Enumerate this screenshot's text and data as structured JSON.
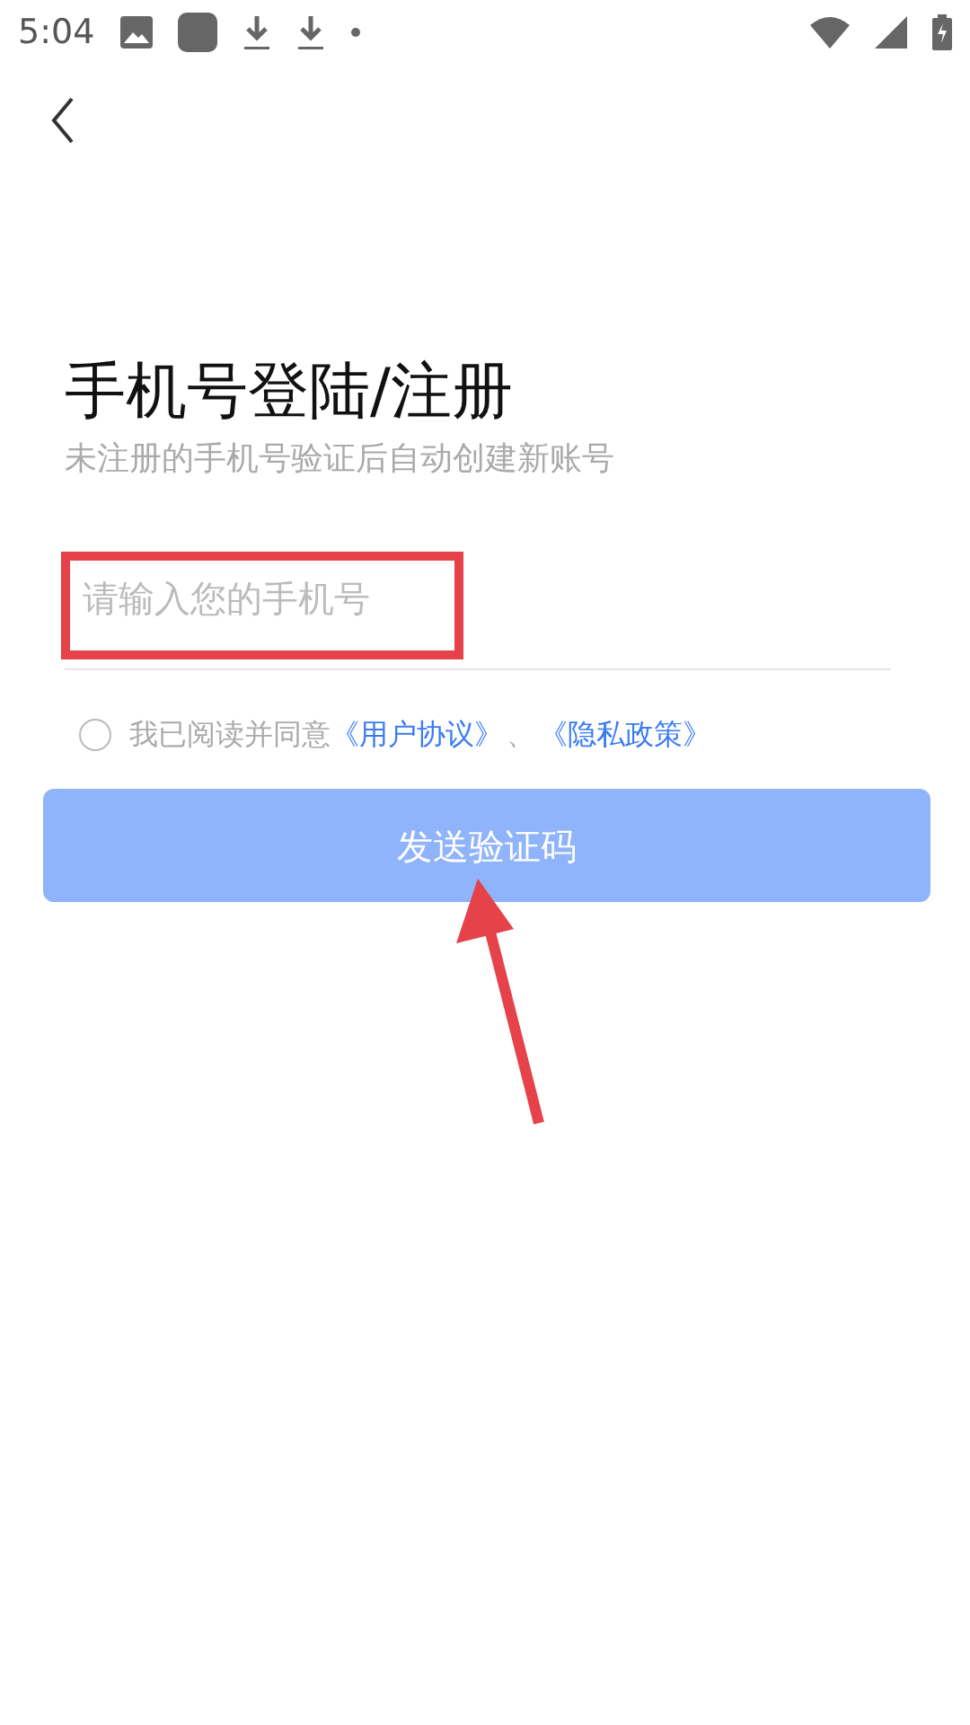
{
  "status_bar": {
    "time": "5:04"
  },
  "title": "手机号登陆/注册",
  "subtitle": "未注册的手机号验证后自动创建新账号",
  "phone_field": {
    "placeholder": "请输入您的手机号"
  },
  "agreement": {
    "checked": false,
    "text": "我已阅读并同意",
    "links": [
      "《用户协议》",
      "《隐私政策》"
    ],
    "separator": "、"
  },
  "submit_button": {
    "label": "发送验证码",
    "disabled": true
  },
  "annotations": {
    "highlight_box": true,
    "arrow": true
  }
}
